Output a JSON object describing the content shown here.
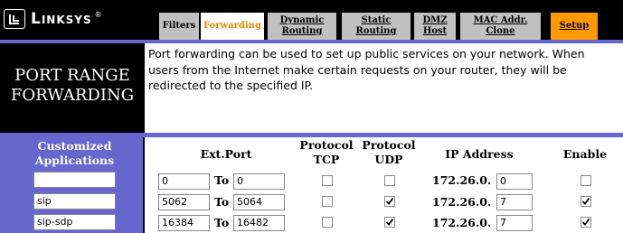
{
  "brand": {
    "name": "Linksys",
    "reg": "®"
  },
  "tabs": [
    {
      "label": "Filters",
      "state": "normal"
    },
    {
      "label": "Forwarding",
      "state": "active"
    },
    {
      "label": "Dynamic Routing",
      "state": "normal"
    },
    {
      "label": "Static Routing",
      "state": "normal"
    },
    {
      "label": "DMZ Host",
      "state": "normal"
    },
    {
      "label": "MAC Addr. Clone",
      "state": "normal"
    },
    {
      "label": "Setup",
      "state": "highlight"
    }
  ],
  "page": {
    "title_line1": "PORT RANGE",
    "title_line2": "FORWARDING",
    "description_line1": "Port forwarding can be used to set up public services on your network. When",
    "description_line2": "users from the Internet make certain requests on your router, they will be",
    "description_line3": "redirected to the specified IP."
  },
  "table": {
    "headers": {
      "applications_line1": "Customized",
      "applications_line2": "Applications",
      "ext_port": "Ext.Port",
      "tcp_line1": "Protocol",
      "tcp_line2": "TCP",
      "udp_line1": "Protocol",
      "udp_line2": "UDP",
      "ip_address": "IP Address",
      "enable": "Enable"
    },
    "to_label": "To",
    "ip_prefix": "172.26.0.",
    "rows": [
      {
        "app": "",
        "start": "0",
        "end": "0",
        "tcp": false,
        "udp": false,
        "ip": "0",
        "enable": false
      },
      {
        "app": "sip",
        "start": "5062",
        "end": "5064",
        "tcp": false,
        "udp": true,
        "ip": "7",
        "enable": true
      },
      {
        "app": "sip-sdp",
        "start": "16384",
        "end": "16482",
        "tcp": false,
        "udp": true,
        "ip": "7",
        "enable": true
      }
    ]
  },
  "colors": {
    "purple": "#6666cc",
    "accent": "#e08a00",
    "setup": "#ff9900",
    "tab_bg": "#c0c0c0"
  }
}
